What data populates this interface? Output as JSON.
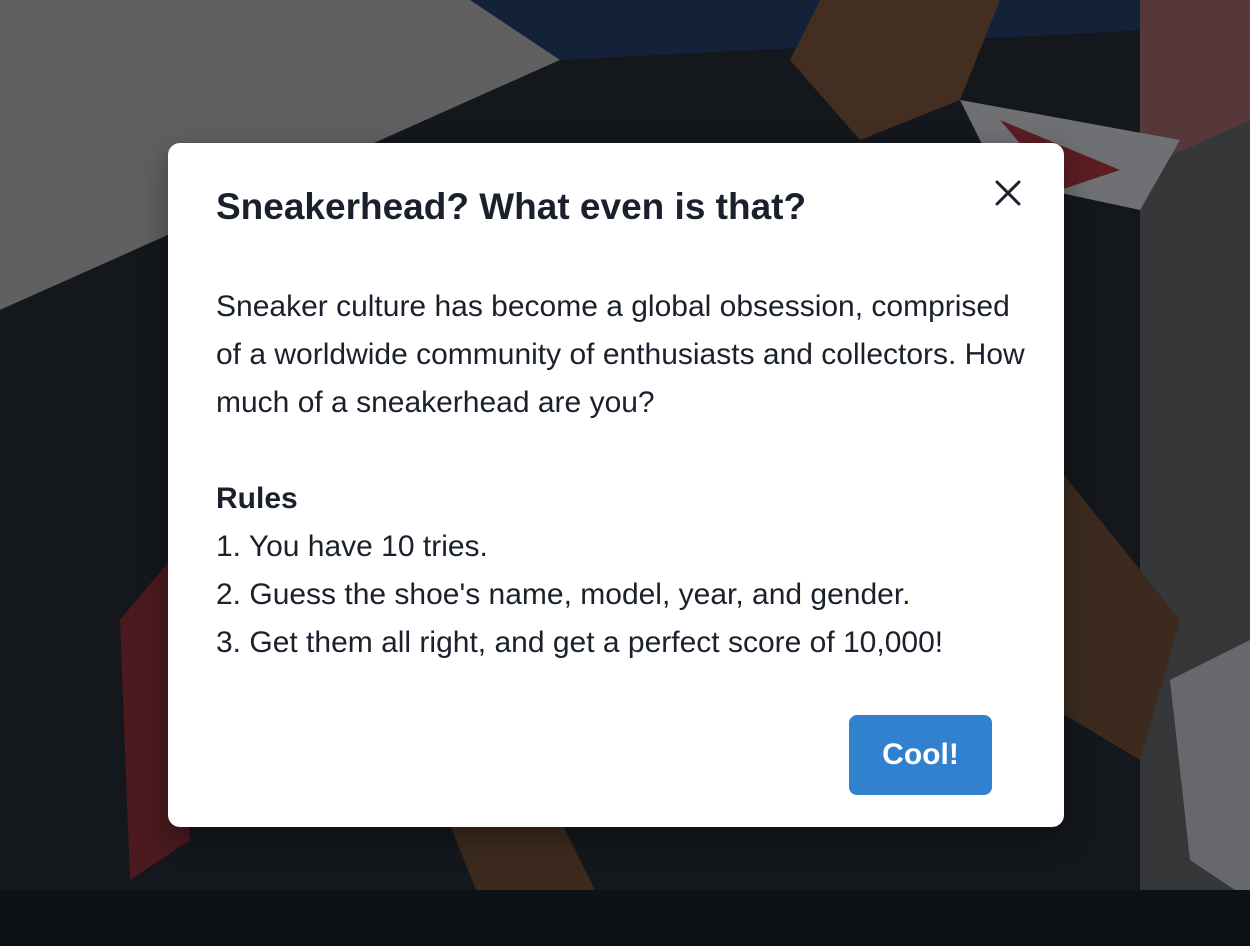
{
  "modal": {
    "title": "Sneakerhead? What even is that?",
    "intro": "Sneaker culture has become a global obsession, comprised of a worldwide community of enthusiasts and collectors. How much of a sneakerhead are you?",
    "rules_heading": "Rules",
    "rules": [
      "1. You have 10 tries.",
      "2. Guess the shoe's name, model, year, and gender.",
      "3. Get them all right, and get a perfect score of 10,000!"
    ],
    "confirm_label": "Cool!",
    "close_icon": "close-icon"
  },
  "colors": {
    "accent": "#3182ce",
    "text": "#1a202c",
    "modal_background": "#ffffff"
  }
}
